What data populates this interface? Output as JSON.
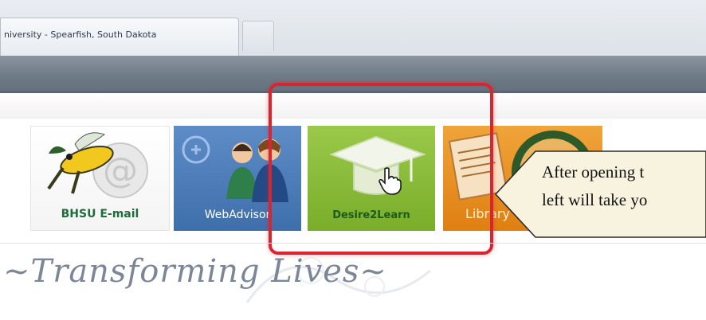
{
  "browser": {
    "active_tab_title": "niversity - Spearfish, South Dakota"
  },
  "portal": {
    "tiles": [
      {
        "label": "BHSU E-mail",
        "icon": "hornet-mascot-icon"
      },
      {
        "label": "WebAdvisor",
        "icon": "people-icon"
      },
      {
        "label": "Desire2Learn",
        "icon": "graduation-cap-icon"
      },
      {
        "label": "Library",
        "icon": "document-stack-icon"
      }
    ],
    "slogan": "~Transforming Lives~"
  },
  "callout": {
    "line1": "After opening t",
    "line2": "left will take yo"
  },
  "colors": {
    "highlight": "#d9252f",
    "d2l_green": "#86b935",
    "webadvisor_blue": "#4f7fbd",
    "library_orange": "#e98d22"
  }
}
